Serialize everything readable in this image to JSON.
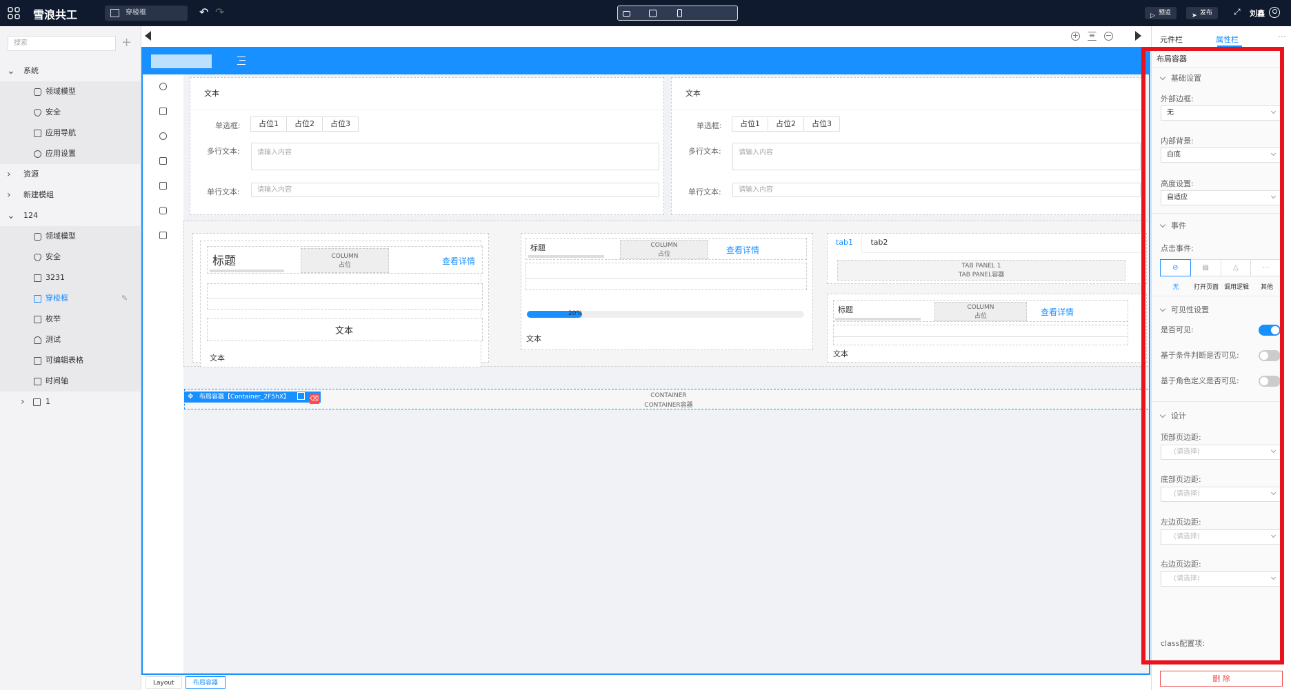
{
  "topbar": {
    "app_name": "雪浪共工",
    "page_name": "穿梭框",
    "preview": "预览",
    "publish": "发布",
    "user": "刘鑫",
    "colors": {
      "bg": "#0f1a2e",
      "accent": "#1890ff"
    }
  },
  "left": {
    "search_placeholder": "搜索",
    "tree": [
      {
        "label": "系统",
        "level": 0,
        "arrow": "▾"
      },
      {
        "label": "领域模型",
        "level": 1,
        "icon": "cube-icon"
      },
      {
        "label": "安全",
        "level": 1,
        "icon": "shield-icon"
      },
      {
        "label": "应用导航",
        "level": 1,
        "icon": "grid-icon"
      },
      {
        "label": "应用设置",
        "level": 1,
        "icon": "gear-icon"
      },
      {
        "label": "资源",
        "level": 0,
        "arrow": "›"
      },
      {
        "label": "新建模组",
        "level": 0,
        "arrow": "›"
      },
      {
        "label": "124",
        "level": 0,
        "arrow": "▾"
      },
      {
        "label": "领域模型",
        "level": 1,
        "icon": "cube-icon"
      },
      {
        "label": "安全",
        "level": 1,
        "icon": "shield-icon"
      },
      {
        "label": "3231",
        "level": 1,
        "icon": "page-icon"
      },
      {
        "label": "穿梭框",
        "level": 1,
        "icon": "page-icon",
        "active": true
      },
      {
        "label": "枚举",
        "level": 1,
        "icon": "enum-icon"
      },
      {
        "label": "测试",
        "level": 1,
        "icon": "bell-icon"
      },
      {
        "label": "可编辑表格",
        "level": 1,
        "icon": "page-icon"
      },
      {
        "label": "时间轴",
        "level": 1,
        "icon": "page-icon"
      },
      {
        "label": "1",
        "level": 2,
        "icon": "folder-icon",
        "arrow": "›"
      }
    ]
  },
  "canvas": {
    "form1": {
      "title": "文本",
      "radio_label": "单选框:",
      "radios": [
        "占位1",
        "占位2",
        "占位3"
      ],
      "textarea_label": "多行文本:",
      "textarea_placeholder": "请输入内容",
      "input_label": "单行文本:",
      "input_placeholder": "请输入内容"
    },
    "form2": {
      "title": "文本",
      "radio_label": "单选框:",
      "radios": [
        "占位1",
        "占位2",
        "占位3"
      ],
      "textarea_label": "多行文本:",
      "textarea_placeholder": "请输入内容",
      "input_label": "单行文本:",
      "input_placeholder": "请输入内容"
    },
    "block1": {
      "title": "标题",
      "col_line1": "COLUMN",
      "col_line2": "占位",
      "link": "查看详情",
      "inner_text": "文本",
      "text": "文本"
    },
    "block2": {
      "title": "标题",
      "col_line1": "COLUMN",
      "col_line2": "占位",
      "link": "查看详情",
      "progress_label": "20%",
      "progress": 0.2,
      "text": "文本"
    },
    "block3": {
      "tabs": [
        "tab1",
        "tab2"
      ],
      "panel_line1": "TAB PANEL 1",
      "panel_line2": "TAB PANEL容器",
      "title": "标题",
      "col_line1": "COLUMN",
      "col_line2": "占位",
      "link": "查看详情",
      "text": "文本"
    },
    "selected": {
      "label": "布局容器【Container_2F5hX】",
      "line1": "CONTAINER",
      "line2": "CONTAINER容器"
    }
  },
  "breadcrumb": [
    "Layout",
    "布局容器"
  ],
  "right": {
    "tabs": [
      "元件栏",
      "属性栏"
    ],
    "active_tab": "属性栏",
    "panel_title": "布局容器",
    "sections": {
      "basic": "基础设置",
      "event": "事件",
      "visibility": "可见性设置",
      "design": "设计"
    },
    "outer_border_label": "外部边框:",
    "outer_border_value": "无",
    "inner_bg_label": "内部背景:",
    "inner_bg_value": "白底",
    "height_label": "高度设置:",
    "height_value": "自适应",
    "click_event_label": "点击事件:",
    "event_options": [
      "无",
      "打开页面",
      "调用逻辑",
      "其他"
    ],
    "visible_label": "是否可见:",
    "visible_on": true,
    "cond_visible_label": "基于条件判断是否可见:",
    "cond_visible_on": false,
    "role_visible_label": "基于角色定义是否可见:",
    "role_visible_on": false,
    "top_margin_label": "顶部页边距:",
    "bottom_margin_label": "底部页边距:",
    "left_margin_label": "左边页边距:",
    "right_margin_label": "右边页边距:",
    "select_placeholder": "(请选择)",
    "class_label": "class配置项:",
    "delete_button": "删 除"
  }
}
